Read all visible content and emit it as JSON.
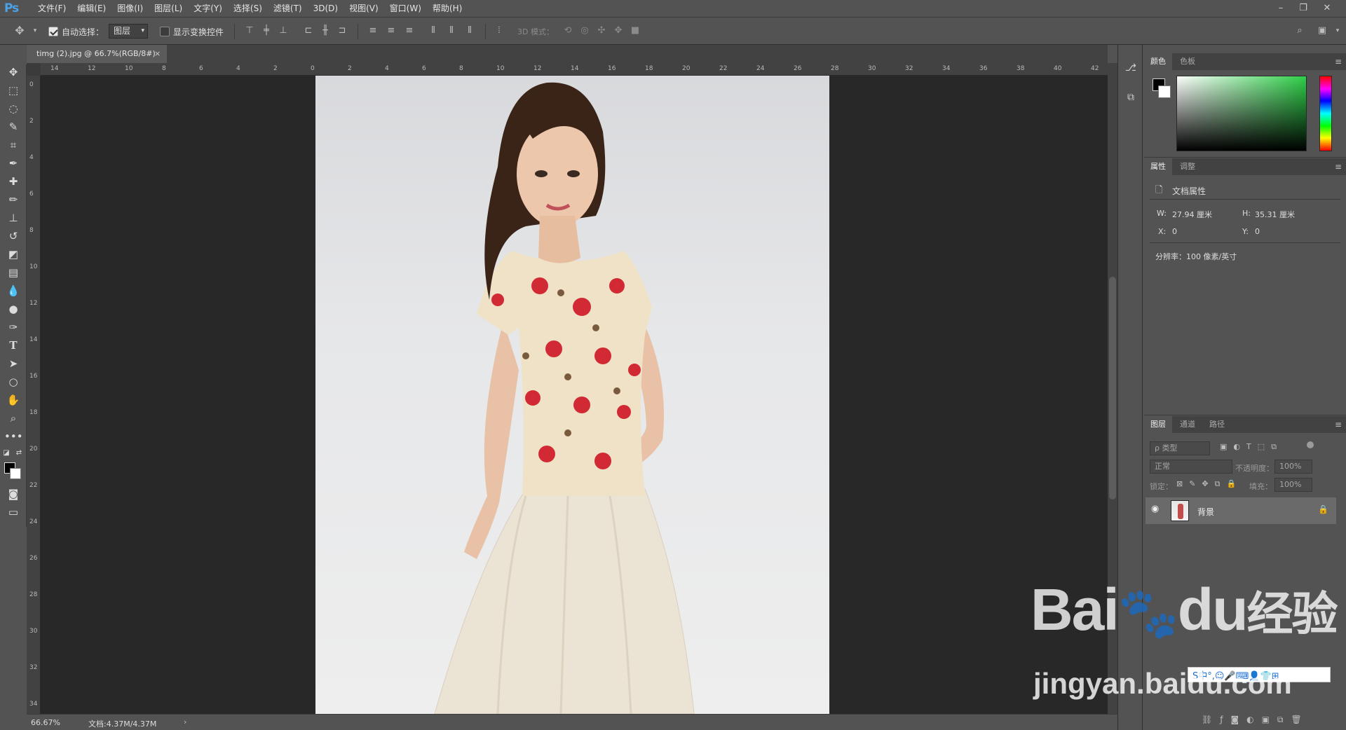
{
  "app": {
    "logo": "Ps"
  },
  "menu": [
    "文件(F)",
    "编辑(E)",
    "图像(I)",
    "图层(L)",
    "文字(Y)",
    "选择(S)",
    "滤镜(T)",
    "3D(D)",
    "视图(V)",
    "窗口(W)",
    "帮助(H)"
  ],
  "options": {
    "auto_select_label": "自动选择：",
    "auto_select_value": "图层",
    "show_transform_label": "显示变换控件",
    "mode_3d_label": "3D 模式："
  },
  "document": {
    "tab_title": "timg (2).jpg @ 66.7%(RGB/8#)",
    "close_glyph": "×"
  },
  "rulers": {
    "h_labels": [
      "14",
      "12",
      "10",
      "8",
      "6",
      "4",
      "2",
      "0",
      "2",
      "4",
      "6",
      "8",
      "10",
      "12",
      "14",
      "16",
      "18",
      "20",
      "22",
      "24",
      "26",
      "28",
      "30",
      "32",
      "34",
      "36",
      "38",
      "40",
      "42"
    ],
    "v_labels": [
      "0",
      "2",
      "4",
      "6",
      "8",
      "10",
      "12",
      "14",
      "16",
      "18",
      "20",
      "22",
      "24",
      "26",
      "28",
      "30",
      "32",
      "34"
    ]
  },
  "status": {
    "zoom": "66.67%",
    "doc_info": "文档:4.37M/4.37M"
  },
  "panels": {
    "color_tabs": [
      "颜色",
      "色板"
    ],
    "props_tabs": [
      "属性",
      "调整"
    ],
    "props_title": "文档属性",
    "w_label": "W:",
    "w_value": "27.94 厘米",
    "h_label": "H:",
    "h_value": "35.31 厘米",
    "x_label": "X:",
    "x_value": "0",
    "y_label": "Y:",
    "y_value": "0",
    "resolution": "分辨率：100 像素/英寸",
    "layers_tabs": [
      "图层",
      "通道",
      "路径"
    ],
    "kind_placeholder": "ρ 类型",
    "blend_mode": "正常",
    "opacity_label": "不透明度：",
    "opacity_value": "100%",
    "lock_label": "锁定：",
    "fill_label": "填充：",
    "fill_value": "100%",
    "layer_name": "背景"
  },
  "watermark": {
    "brand": "Bai",
    "brand2": "du",
    "brand3": "经验",
    "url": "jingyan.baidu.com",
    "ime": "S中°,☺🎤⌨👤👕⊞"
  },
  "colors": {
    "accent_logo": "#4aa3e8",
    "ui_bg": "#535353",
    "canvas_bg": "#282828",
    "foreground": "#000000",
    "background": "#ffffff"
  }
}
